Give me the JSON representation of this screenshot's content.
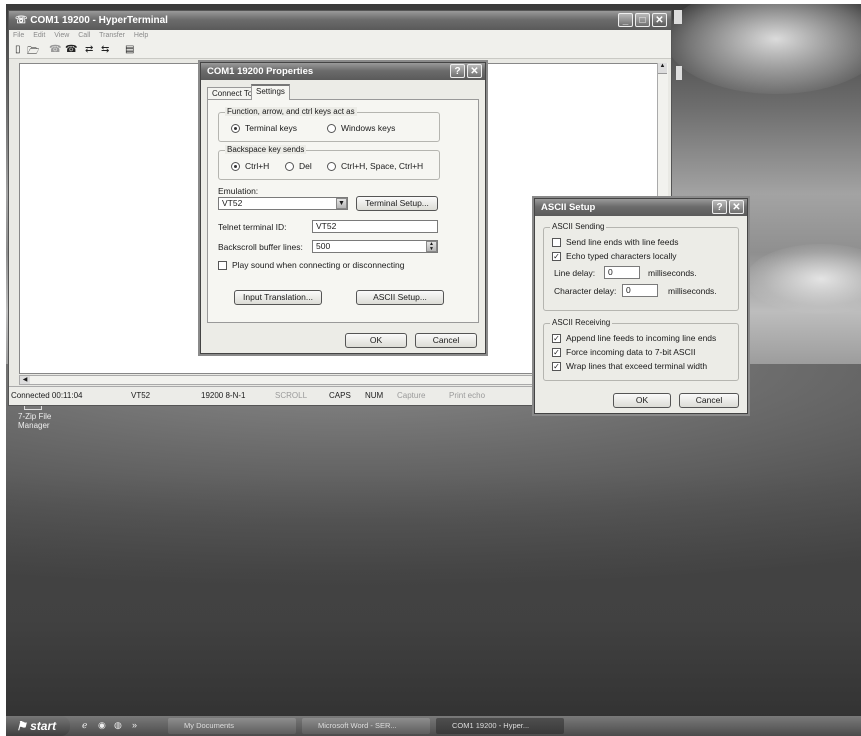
{
  "hyperterminal": {
    "title": "COM1 19200 - HyperTerminal",
    "menu": [
      "File",
      "Edit",
      "View",
      "Call",
      "Transfer",
      "Help"
    ],
    "status": {
      "connected": "Connected 00:11:04",
      "emulation": "VT52",
      "settings": "19200 8-N-1",
      "scroll": "SCROLL",
      "caps": "CAPS",
      "num": "NUM",
      "capture": "Capture",
      "print_echo": "Print echo"
    }
  },
  "properties": {
    "title": "COM1 19200 Properties",
    "tabs": [
      "Connect To",
      "Settings"
    ],
    "function_keys_group": "Function, arrow, and ctrl keys act as",
    "terminal_keys": "Terminal keys",
    "windows_keys": "Windows keys",
    "backspace_group": "Backspace key sends",
    "ctrl_h": "Ctrl+H",
    "del": "Del",
    "ctrl_h_space": "Ctrl+H, Space, Ctrl+H",
    "emulation_label": "Emulation:",
    "emulation_value": "VT52",
    "terminal_setup_button": "Terminal Setup...",
    "telnet_label": "Telnet terminal ID:",
    "telnet_value": "VT52",
    "backscroll_label": "Backscroll buffer lines:",
    "backscroll_value": "500",
    "play_sound": "Play sound when connecting or disconnecting",
    "input_translation_button": "Input Translation...",
    "ascii_setup_button": "ASCII Setup...",
    "ok": "OK",
    "cancel": "Cancel"
  },
  "ascii_setup": {
    "title": "ASCII Setup",
    "sending_group": "ASCII Sending",
    "send_line_ends": "Send line ends with line feeds",
    "echo_typed": "Echo typed characters locally",
    "line_delay_label": "Line delay:",
    "line_delay_value": "0",
    "char_delay_label": "Character delay:",
    "char_delay_value": "0",
    "milliseconds": "milliseconds.",
    "receiving_group": "ASCII Receiving",
    "append_line_feeds": "Append line feeds to incoming line ends",
    "force_7bit": "Force incoming data to 7-bit ASCII",
    "wrap_lines": "Wrap lines that exceed terminal width",
    "ok": "OK",
    "cancel": "Cancel"
  },
  "desktop": {
    "icon_label_1": "7-Zip File",
    "icon_label_2": "Manager"
  },
  "taskbar": {
    "start": "start",
    "tasks": [
      "My Documents",
      "Microsoft Word - SER...",
      "COM1 19200 - Hyper..."
    ]
  },
  "states": {
    "terminal_keys": true,
    "ctrl_h": true,
    "send_line_ends": false,
    "echo_typed": true,
    "play_sound": false,
    "append_line_feeds": true,
    "force_7bit": true,
    "wrap_lines": true
  }
}
